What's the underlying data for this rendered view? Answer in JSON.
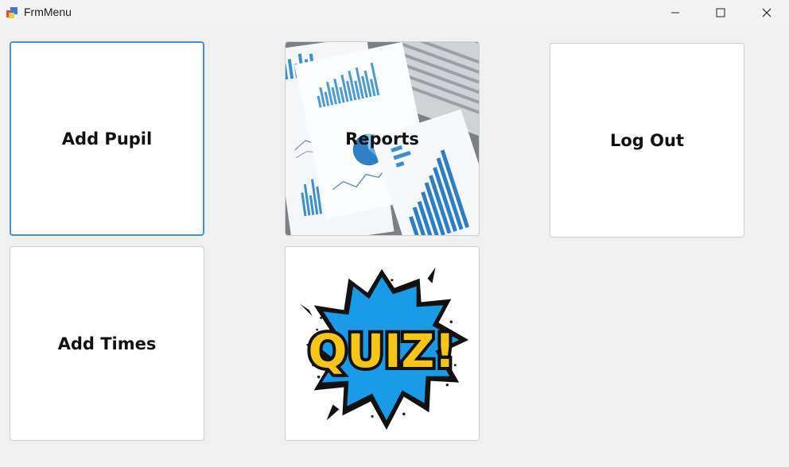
{
  "window": {
    "title": "FrmMenu",
    "icon": "winforms-app-icon",
    "controls": [
      "minimize-icon",
      "maximize-icon",
      "close-icon"
    ]
  },
  "tiles": {
    "add_pupil": {
      "label": "Add Pupil"
    },
    "reports": {
      "label": "Reports",
      "image": "report-charts-photo"
    },
    "log_out": {
      "label": "Log Out"
    },
    "add_times": {
      "label": "Add Times"
    },
    "quiz": {
      "image_text": "QUIZ!",
      "image": "quiz-comic-burst"
    }
  },
  "colors": {
    "focus_border": "#4a90d0",
    "quiz_blue": "#1a9be8",
    "quiz_yellow": "#f5c518",
    "chart_blue": "#3a8fd0"
  }
}
